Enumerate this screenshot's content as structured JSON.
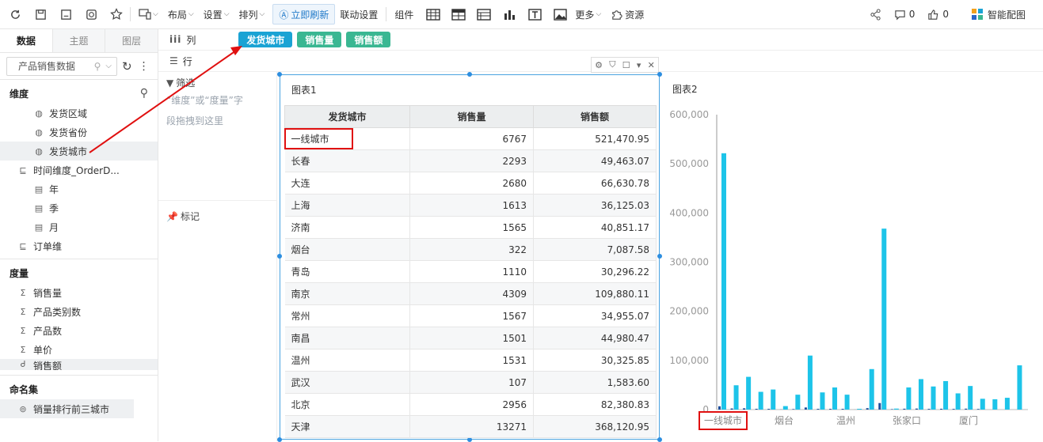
{
  "toolbar": {
    "layout": "布局",
    "settings": "设置",
    "arrange": "排列",
    "refresh": "立即刷新",
    "linkage": "联动设置",
    "components": "组件",
    "more": "更多",
    "resources": "资源",
    "comments_count": "0",
    "likes_count": "0",
    "smart_chart": "智能配图"
  },
  "left": {
    "tabs": [
      "数据",
      "主题",
      "图层"
    ],
    "dataset": "产品销售数据",
    "dim_title": "维度",
    "dims": [
      "发货区域",
      "发货省份",
      "发货城市"
    ],
    "time_dim": "时间维度_OrderD...",
    "time_items": [
      "年",
      "季",
      "月"
    ],
    "order_dim": "订单维",
    "measure_title": "度量",
    "measures": [
      "销售量",
      "产品类别数",
      "产品数",
      "单价",
      "销售额"
    ],
    "named_set_title": "命名集",
    "named_set": "销量排行前三城市"
  },
  "shelves": {
    "col_label": "列",
    "row_label": "行",
    "col_pills": [
      "发货城市",
      "销售量",
      "销售额"
    ]
  },
  "mid": {
    "filter_label": "筛选",
    "filter_hint_1": "“维度”或“度量”字",
    "filter_hint_2": "段拖拽到这里",
    "mark_label": "标记"
  },
  "table": {
    "title": "图表1",
    "headers": [
      "发货城市",
      "销售量",
      "销售额"
    ],
    "rows": [
      [
        "一线城市",
        "6767",
        "521,470.95"
      ],
      [
        "长春",
        "2293",
        "49,463.07"
      ],
      [
        "大连",
        "2680",
        "66,630.78"
      ],
      [
        "上海",
        "1613",
        "36,125.03"
      ],
      [
        "济南",
        "1565",
        "40,851.17"
      ],
      [
        "烟台",
        "322",
        "7,087.58"
      ],
      [
        "青岛",
        "1110",
        "30,296.22"
      ],
      [
        "南京",
        "4309",
        "109,880.11"
      ],
      [
        "常州",
        "1567",
        "34,955.07"
      ],
      [
        "南昌",
        "1501",
        "44,980.47"
      ],
      [
        "温州",
        "1531",
        "30,325.85"
      ],
      [
        "武汉",
        "107",
        "1,583.60"
      ],
      [
        "北京",
        "2956",
        "82,380.83"
      ],
      [
        "天津",
        "13271",
        "368,120.95"
      ]
    ]
  },
  "chart_data": {
    "type": "bar",
    "title": "图表2",
    "ylim": [
      0,
      600000
    ],
    "yticks": [
      "600,000",
      "500,000",
      "400,000",
      "300,000",
      "200,000",
      "100,000",
      "0"
    ],
    "xticks": [
      "一线城市",
      "烟台",
      "温州",
      "张家口",
      "厦门"
    ],
    "series": [
      {
        "color": "#1e4e9c",
        "values": [
          6767,
          2293,
          2680,
          1613,
          1565,
          322,
          1110,
          4309,
          1567,
          1501,
          1531,
          107,
          2956,
          13271,
          900,
          1800,
          2100,
          1500,
          1700,
          1400,
          1900,
          1300
        ]
      },
      {
        "color": "#1dc4e9",
        "values": [
          521471,
          49463,
          66631,
          36125,
          40851,
          7088,
          30296,
          109880,
          34955,
          44980,
          30326,
          1584,
          82381,
          368121,
          2000,
          45000,
          62000,
          47000,
          58000,
          33000,
          48000,
          22000
        ]
      }
    ],
    "extra_bars": [
      21000,
      24000,
      90000
    ]
  }
}
